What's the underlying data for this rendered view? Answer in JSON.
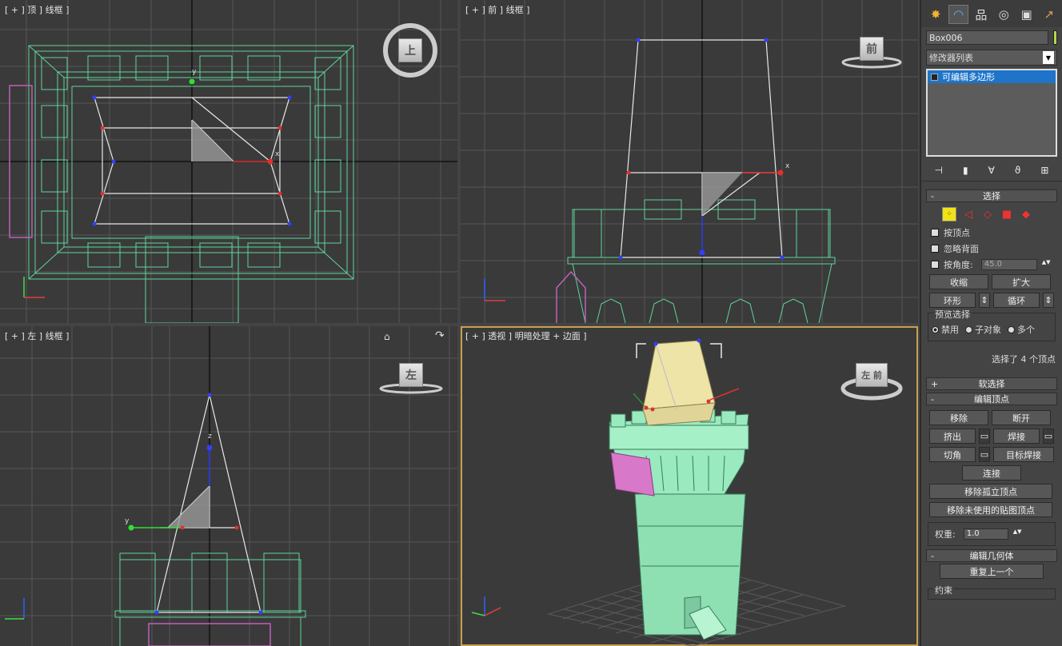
{
  "viewports": {
    "top": {
      "label": "[ + ] 顶 ] 线框 ]",
      "cube": "上"
    },
    "front": {
      "label": "[ + ] 前 ] 线框 ]",
      "cube": "前"
    },
    "left": {
      "label": "[ + ] 左 ] 线框 ]",
      "cube": "左"
    },
    "persp": {
      "label": "[ + ] 透视 ] 明暗处理 + 边面 ]",
      "cube": "左 前"
    }
  },
  "panel": {
    "tabs": [
      "create-icon",
      "modify-icon",
      "hierarchy-icon",
      "motion-icon",
      "display-icon",
      "utilities-icon"
    ],
    "object_name": "Box006",
    "object_color": "#b4d84c",
    "modifier_list": "修改器列表",
    "stack_item": "可编辑多边形",
    "selection": {
      "title": "选择",
      "by_vertex": "按顶点",
      "ignore_backface": "忽略背面",
      "by_angle": "按角度:",
      "angle_value": "45.0",
      "shrink": "收缩",
      "grow": "扩大",
      "ring": "环形",
      "loop": "循环",
      "preview_group": "预览选择",
      "preview_off": "禁用",
      "preview_subobj": "子对象",
      "preview_multi": "多个",
      "selected_info": "选择了 4 个顶点"
    },
    "soft_selection": "软选择",
    "edit_vertices": {
      "title": "编辑顶点",
      "remove": "移除",
      "break": "断开",
      "extrude": "挤出",
      "weld": "焊接",
      "chamfer": "切角",
      "target_weld": "目标焊接",
      "connect": "连接",
      "remove_isolated": "移除孤立顶点",
      "remove_unused": "移除未使用的贴图顶点",
      "weight_label": "权重:",
      "weight_value": "1.0"
    },
    "edit_geometry": {
      "title": "编辑几何体",
      "repeat_last": "重复上一个",
      "constraints": "约束"
    }
  }
}
